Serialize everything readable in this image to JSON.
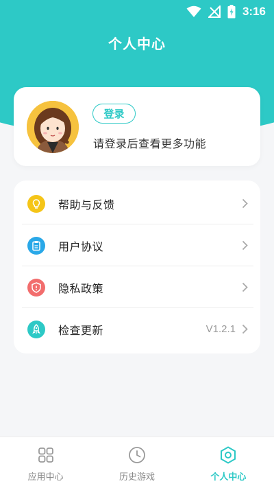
{
  "status_bar": {
    "time": "3:16"
  },
  "header": {
    "title": "个人中心"
  },
  "user_card": {
    "login_label": "登录",
    "hint": "请登录后查看更多功能"
  },
  "menu": {
    "items": [
      {
        "label": "帮助与反馈",
        "icon": "lightbulb-icon",
        "color": "#f5c518",
        "value": ""
      },
      {
        "label": "用户协议",
        "icon": "document-icon",
        "color": "#29a8e8",
        "value": ""
      },
      {
        "label": "隐私政策",
        "icon": "shield-icon",
        "color": "#f26d6d",
        "value": ""
      },
      {
        "label": "检查更新",
        "icon": "rocket-icon",
        "color": "#2dc9c6",
        "value": "V1.2.1"
      }
    ]
  },
  "tabbar": {
    "items": [
      {
        "label": "应用中心",
        "icon": "grid-icon",
        "active": false
      },
      {
        "label": "历史游戏",
        "icon": "clock-icon",
        "active": false
      },
      {
        "label": "个人中心",
        "icon": "hexagon-icon",
        "active": true
      }
    ]
  },
  "colors": {
    "accent": "#2dc9c6",
    "background": "#f5f6f8"
  }
}
